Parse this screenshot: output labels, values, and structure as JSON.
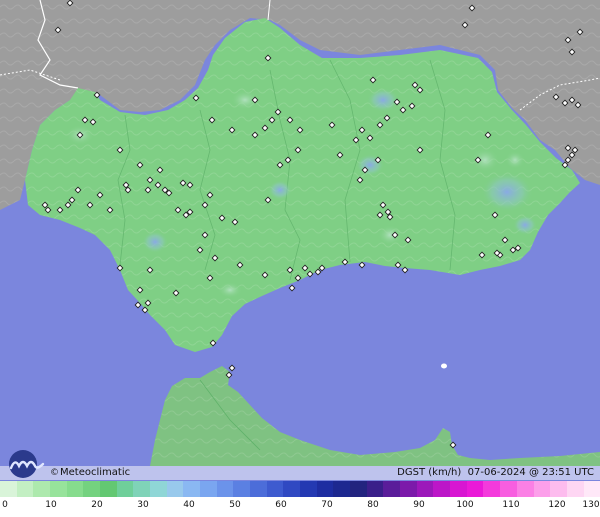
{
  "brand": {
    "copyright_symbol": "©",
    "name": "Meteoclimatic"
  },
  "caption": {
    "variable": "DGST",
    "unit": "(km/h)",
    "date": "07-06-2024",
    "at": "@",
    "time": "23:51",
    "tz": "UTC"
  },
  "scale": {
    "ticks": [
      "0",
      "10",
      "20",
      "30",
      "40",
      "50",
      "60",
      "70",
      "80",
      "90",
      "100",
      "110",
      "120",
      "130"
    ],
    "colors": [
      "#d9f4d9",
      "#c3efc3",
      "#ade9ad",
      "#97e39b",
      "#86dc8d",
      "#74d27f",
      "#63c872",
      "#6fcf9a",
      "#7fd3b8",
      "#8fd6d6",
      "#98c9ec",
      "#8ab8f2",
      "#7aa6f0",
      "#6b93ea",
      "#5b80e2",
      "#4c6dd9",
      "#3e5bcf",
      "#3049c2",
      "#2439b2",
      "#1e2da1",
      "#1d2890",
      "#22247f",
      "#3a1f8a",
      "#5a1d9a",
      "#7c1aaa",
      "#9c18ba",
      "#bc16c8",
      "#d816d2",
      "#ea1ad8",
      "#f43adc",
      "#f85ee0",
      "#fb80e5",
      "#fc9fea",
      "#fdbcee",
      "#fed6f3",
      "#ffe8f8"
    ]
  },
  "map": {
    "sea_color": "#7b86dd",
    "land_color": "#7fcf85",
    "foreign_land_color": "#9a9a9a",
    "station_marker_color": "#222222"
  }
}
